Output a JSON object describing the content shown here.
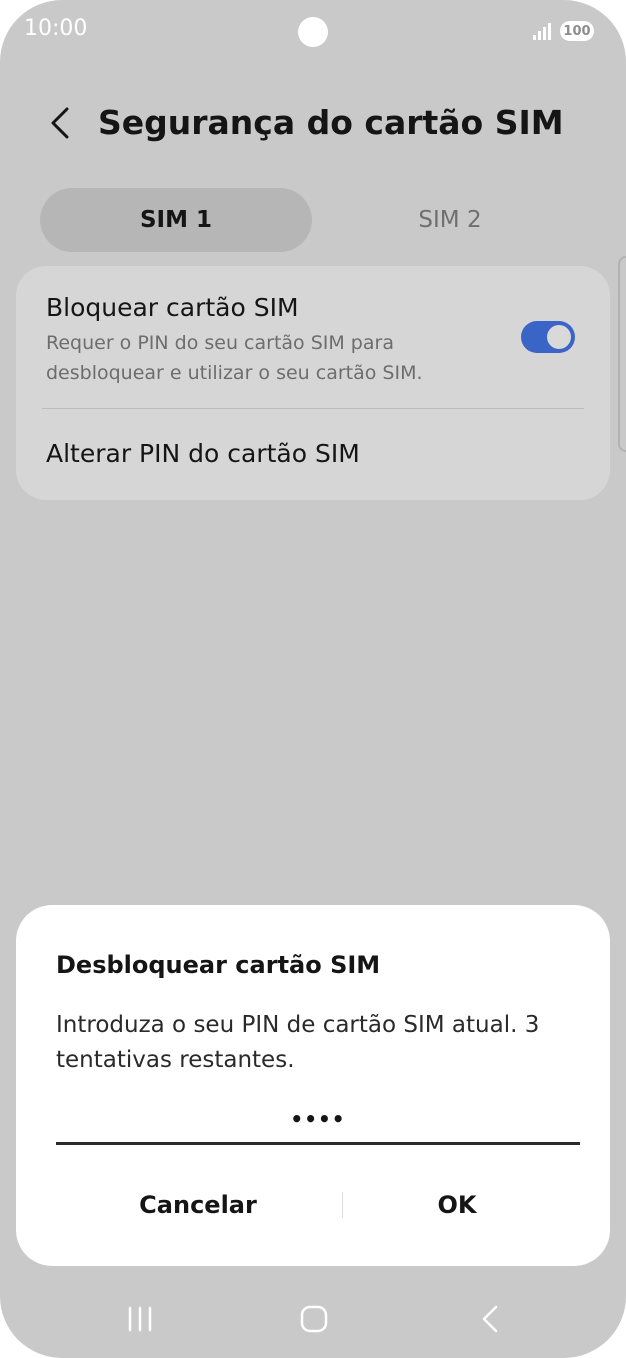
{
  "status_bar": {
    "time": "10:00",
    "battery": "100",
    "icons": [
      "signal-icon",
      "battery-icon"
    ]
  },
  "header": {
    "title": "Segurança do cartão SIM",
    "back_icon": "chevron-left-icon"
  },
  "tabs": [
    {
      "label": "SIM 1",
      "selected": true
    },
    {
      "label": "SIM 2",
      "selected": false
    }
  ],
  "settings": {
    "lock_sim": {
      "title": "Bloquear cartão SIM",
      "description": "Requer o PIN do seu cartão SIM para desbloquear e utilizar o seu cartão SIM.",
      "enabled": true
    },
    "change_pin": {
      "title": "Alterar PIN do cartão SIM"
    }
  },
  "dialog": {
    "title": "Desbloquear cartão SIM",
    "message": "Introduza o seu PIN de cartão SIM atual. 3 tentativas restantes.",
    "pin_value": "••••",
    "cancel_label": "Cancelar",
    "ok_label": "OK"
  },
  "nav_bar": {
    "icons": [
      "recent-apps-icon",
      "home-icon",
      "back-icon"
    ]
  },
  "colors": {
    "accent": "#3b64c7",
    "dimmed_background": "#c9c9c9",
    "dialog_background": "#ffffff"
  }
}
